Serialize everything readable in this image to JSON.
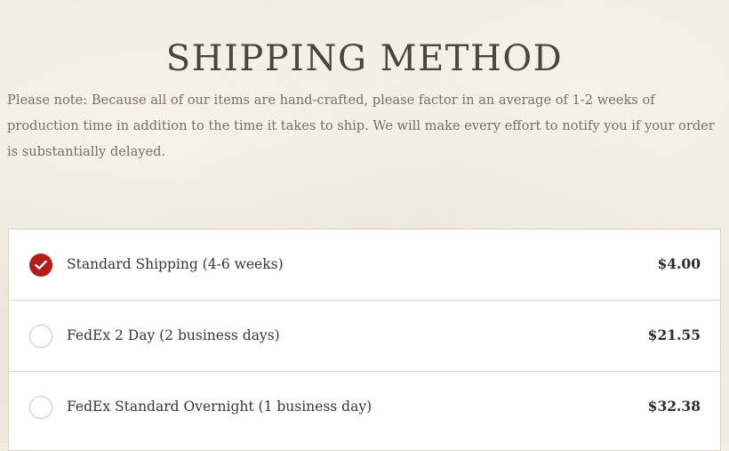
{
  "page": {
    "heading": "SHIPPING METHOD",
    "note": "Please note: Because all of our items are hand-crafted, please factor in an average of 1-2 weeks of production time in addition to the time it takes to ship. We will make every effort to notify you if your order is substantially delayed."
  },
  "shipping_options": [
    {
      "label": "Standard Shipping (4-6 weeks)",
      "price": "$4.00",
      "selected": true
    },
    {
      "label": "FedEx 2 Day (2 business days)",
      "price": "$21.55",
      "selected": false
    },
    {
      "label": "FedEx Standard Overnight (1 business day)",
      "price": "$32.38",
      "selected": false
    }
  ],
  "colors": {
    "accent": "#b21d17",
    "background": "#f1ece1",
    "heading_text": "#4b4542",
    "note_text": "#7a6f63",
    "border": "#d9d3c8"
  },
  "icons": {
    "selected": "checkmark-circle-icon",
    "unselected": "empty-radio-icon"
  }
}
